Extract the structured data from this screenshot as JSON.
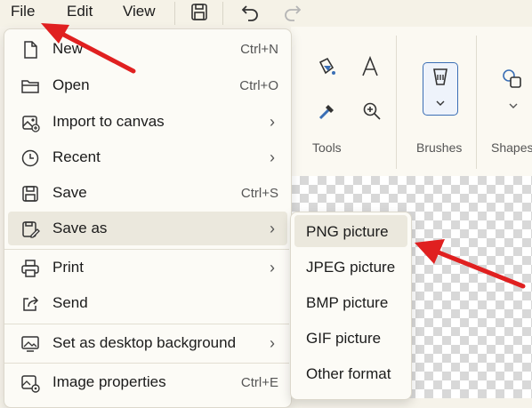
{
  "menubar": {
    "file": "File",
    "edit": "Edit",
    "view": "View"
  },
  "ribbon": {
    "tools_label": "Tools",
    "brushes_label": "Brushes",
    "shapes_label": "Shapes"
  },
  "file_menu": [
    {
      "label": "New",
      "shortcut": "Ctrl+N",
      "icon": "new-file-icon"
    },
    {
      "label": "Open",
      "shortcut": "Ctrl+O",
      "icon": "folder-icon"
    },
    {
      "label": "Import to canvas",
      "arrow": "›",
      "icon": "import-image-icon"
    },
    {
      "label": "Recent",
      "arrow": "›",
      "icon": "clock-icon"
    },
    {
      "label": "Save",
      "shortcut": "Ctrl+S",
      "icon": "save-icon"
    },
    {
      "label": "Save as",
      "arrow": "›",
      "icon": "save-as-icon"
    },
    {
      "label": "Print",
      "arrow": "›",
      "icon": "printer-icon"
    },
    {
      "label": "Send",
      "icon": "share-icon"
    },
    {
      "label": "Set as desktop background",
      "arrow": "›",
      "icon": "desktop-background-icon"
    },
    {
      "label": "Image properties",
      "shortcut": "Ctrl+E",
      "icon": "image-properties-icon"
    }
  ],
  "save_as_submenu": [
    {
      "label": "PNG picture"
    },
    {
      "label": "JPEG picture"
    },
    {
      "label": "BMP picture"
    },
    {
      "label": "GIF picture"
    },
    {
      "label": "Other format"
    }
  ],
  "colors": {
    "annotation_arrow": "#e02020",
    "hover": "#ebe8dd",
    "selected_brush_border": "#3b6fb5"
  }
}
